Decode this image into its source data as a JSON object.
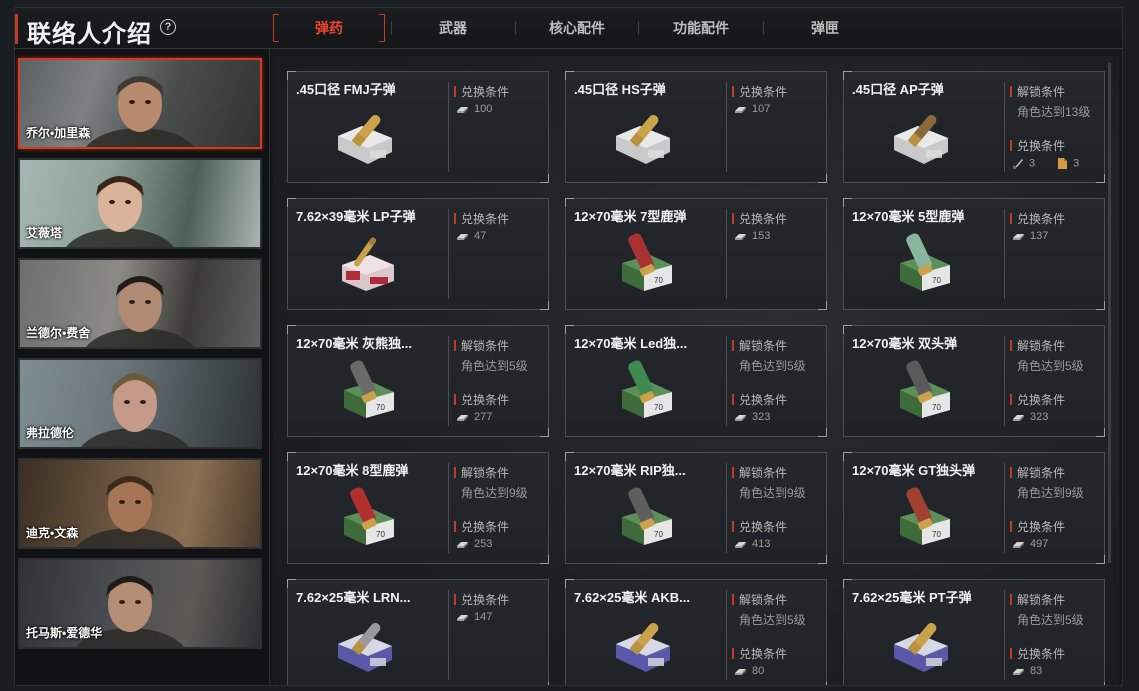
{
  "header": {
    "title": "联络人介绍",
    "help_icon": "?",
    "tabs": [
      "弹药",
      "武器",
      "核心配件",
      "功能配件",
      "弹匣"
    ],
    "active_tab": 0
  },
  "sidebar": {
    "characters": [
      {
        "name": "乔尔•加里森",
        "selected": true
      },
      {
        "name": "艾薇塔",
        "selected": false
      },
      {
        "name": "兰德尔•费舍",
        "selected": false
      },
      {
        "name": "弗拉德伦",
        "selected": false
      },
      {
        "name": "迪克•文森",
        "selected": false
      },
      {
        "name": "托马斯•爱德华",
        "selected": false
      }
    ]
  },
  "items": [
    {
      "name": ".45口径 FMJ子弹",
      "icon": "pistol-ammo-icon",
      "box": "#c9c9c9",
      "bullet": "#c9a24a",
      "unlock": null,
      "exchange_label": "兑换条件",
      "cost": "100"
    },
    {
      "name": ".45口径 HS子弹",
      "icon": "pistol-ammo-icon",
      "box": "#c9c9c9",
      "bullet": "#c9a24a",
      "unlock": null,
      "exchange_label": "兑换条件",
      "cost": "107"
    },
    {
      "name": ".45口径 AP子弹",
      "icon": "pistol-ammo-icon",
      "box": "#c9c9c9",
      "bullet": "#8a6a3a",
      "unlock": {
        "label": "解锁条件",
        "text": "角色达到13级"
      },
      "exchange_label": "兑换条件",
      "cost_items": [
        {
          "icon": "knife-icon",
          "count": "3"
        },
        {
          "icon": "document-icon",
          "count": "3"
        }
      ]
    },
    {
      "name": "7.62×39毫米 LP子弹",
      "icon": "rifle-ammo-icon",
      "box": "#d8c8cc",
      "bullet": "#c9a24a",
      "unlock": null,
      "exchange_label": "兑换条件",
      "cost": "47"
    },
    {
      "name": "12×70毫米 7型鹿弹",
      "icon": "shotgun-shell-icon",
      "box": "#3e6b3a",
      "bullet": "#a83232",
      "unlock": null,
      "exchange_label": "兑换条件",
      "cost": "153"
    },
    {
      "name": "12×70毫米 5型鹿弹",
      "icon": "shotgun-shell-icon",
      "box": "#3e6b3a",
      "bullet": "#8ab6a0",
      "unlock": null,
      "exchange_label": "兑换条件",
      "cost": "137"
    },
    {
      "name": "12×70毫米 灰熊独...",
      "icon": "shotgun-shell-icon",
      "box": "#3e6b3a",
      "bullet": "#6a6a6a",
      "unlock": {
        "label": "解锁条件",
        "text": "角色达到5级"
      },
      "exchange_label": "兑换条件",
      "cost": "277"
    },
    {
      "name": "12×70毫米 Led独...",
      "icon": "shotgun-shell-icon",
      "box": "#3e6b3a",
      "bullet": "#3f8a4e",
      "unlock": {
        "label": "解锁条件",
        "text": "角色达到5级"
      },
      "exchange_label": "兑换条件",
      "cost": "323"
    },
    {
      "name": "12×70毫米 双头弹",
      "icon": "shotgun-shell-icon",
      "box": "#3e6b3a",
      "bullet": "#5a5a5a",
      "unlock": {
        "label": "解锁条件",
        "text": "角色达到5级"
      },
      "exchange_label": "兑换条件",
      "cost": "323"
    },
    {
      "name": "12×70毫米 8型鹿弹",
      "icon": "shotgun-shell-icon",
      "box": "#3e6b3a",
      "bullet": "#b03030",
      "unlock": {
        "label": "解锁条件",
        "text": "角色达到9级"
      },
      "exchange_label": "兑换条件",
      "cost": "253"
    },
    {
      "name": "12×70毫米 RIP独...",
      "icon": "shotgun-shell-icon",
      "box": "#3e6b3a",
      "bullet": "#5e5e5e",
      "unlock": {
        "label": "解锁条件",
        "text": "角色达到9级"
      },
      "exchange_label": "兑换条件",
      "cost": "413"
    },
    {
      "name": "12×70毫米 GT独头弹",
      "icon": "shotgun-shell-icon",
      "box": "#3e6b3a",
      "bullet": "#a04030",
      "unlock": {
        "label": "解锁条件",
        "text": "角色达到9级"
      },
      "exchange_label": "兑换条件",
      "cost": "497"
    },
    {
      "name": "7.62×25毫米 LRN...",
      "icon": "pistol-ammo-icon",
      "box": "#5a58a8",
      "bullet": "#9a9a9a",
      "unlock": null,
      "exchange_label": "兑换条件",
      "cost": "147"
    },
    {
      "name": "7.62×25毫米 AKB...",
      "icon": "pistol-ammo-icon",
      "box": "#5a58a8",
      "bullet": "#c9a24a",
      "unlock": {
        "label": "解锁条件",
        "text": "角色达到5级"
      },
      "exchange_label": "兑换条件",
      "cost": "80"
    },
    {
      "name": "7.62×25毫米 PT子弹",
      "icon": "pistol-ammo-icon",
      "box": "#5a58a8",
      "bullet": "#c9a24a",
      "unlock": {
        "label": "解锁条件",
        "text": "角色达到5级"
      },
      "exchange_label": "兑换条件",
      "cost": "83"
    }
  ],
  "colors": {
    "accent": "#c23b22",
    "active_tab": "#e8462c"
  }
}
